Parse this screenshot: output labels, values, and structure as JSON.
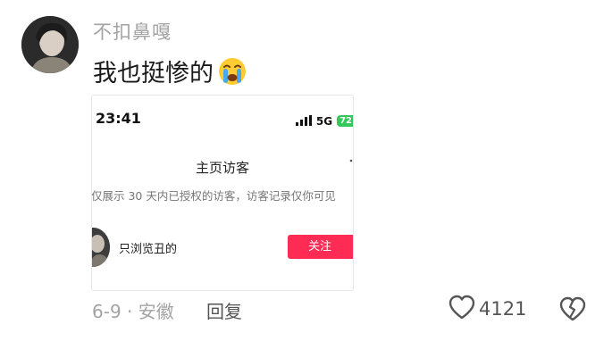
{
  "comment": {
    "username": "不扣鼻嘎",
    "text": "我也挺惨的",
    "emoji": "loudly-crying-face",
    "date": "6-9",
    "location": "安徽",
    "meta_text": "6-9 · 安徽",
    "reply_label": "回复",
    "like_count": "4121"
  },
  "embedded_screenshot": {
    "status_time": "23:41",
    "network": "5G",
    "battery": "72",
    "title": "主页访客",
    "notice": "仅展示 30 天内已授权的访客，访客记录仅你可见",
    "visitor_name": "只浏览丑的",
    "follow_label": "关注"
  },
  "colors": {
    "username": "#a3a3a3",
    "follow_button": "#fe2c55",
    "battery": "#34c759"
  },
  "icons": {
    "like": "heart-outline-icon",
    "dislike": "broken-heart-icon"
  }
}
